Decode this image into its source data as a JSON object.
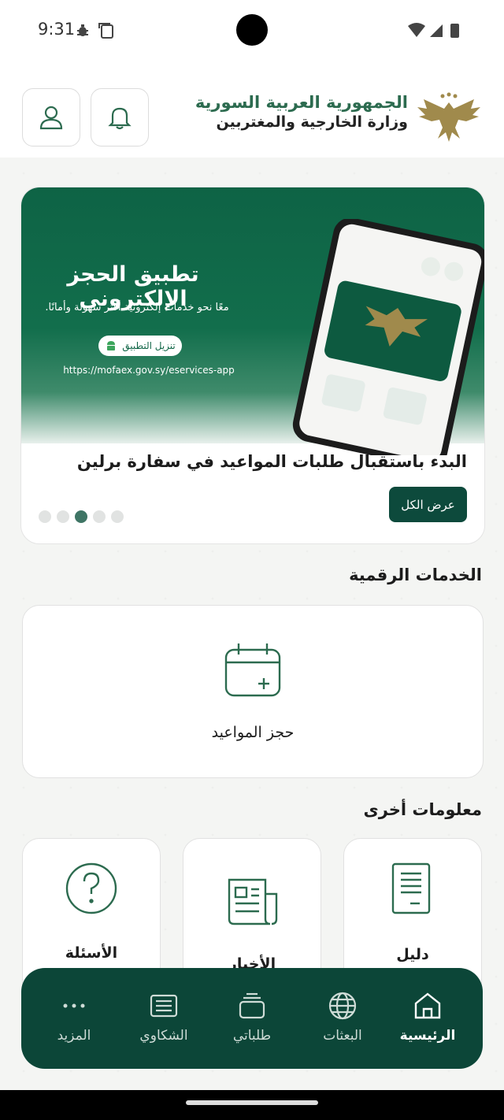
{
  "status_bar": {
    "time": "9:31"
  },
  "header": {
    "line1": "الجمهورية العربية السورية",
    "line2": "وزارة الخارجية والمغتربين"
  },
  "banner": {
    "title": "تطبيق الحجز الإلكتروني",
    "subtitle": "معًا نحو خدمات إلكترونية أكثر سهولة وأمانًا.",
    "pill": "تنزيل التطبيق",
    "url": "https://mofaex.gov.sy/eservices-app",
    "news_title": "البدء باستقبال طلبات المواعيد في سفارة برلين",
    "view_all": "عرض الكل",
    "active_dot": 3,
    "dot_count": 5
  },
  "digital_services": {
    "title": "الخدمات الرقمية",
    "item_label": "حجز المواعيد"
  },
  "other_info": {
    "title": "معلومات أخرى",
    "cards": [
      {
        "label": "دليل",
        "icon": "document-icon"
      },
      {
        "label": "الأخبار",
        "icon": "newspaper-icon"
      },
      {
        "label": "الأسئلة",
        "icon": "question-icon"
      }
    ]
  },
  "nav": {
    "items": [
      {
        "label": "الرئيسية",
        "icon": "home-icon",
        "active": true
      },
      {
        "label": "البعثات",
        "icon": "globe-icon"
      },
      {
        "label": "طلباتي",
        "icon": "stack-icon"
      },
      {
        "label": "الشكاوي",
        "icon": "list-icon"
      },
      {
        "label": "المزيد",
        "icon": "more-icon"
      }
    ]
  },
  "colors": {
    "primary": "#0c4638",
    "accent": "#2c6b4f",
    "banner": "#0e6345"
  }
}
